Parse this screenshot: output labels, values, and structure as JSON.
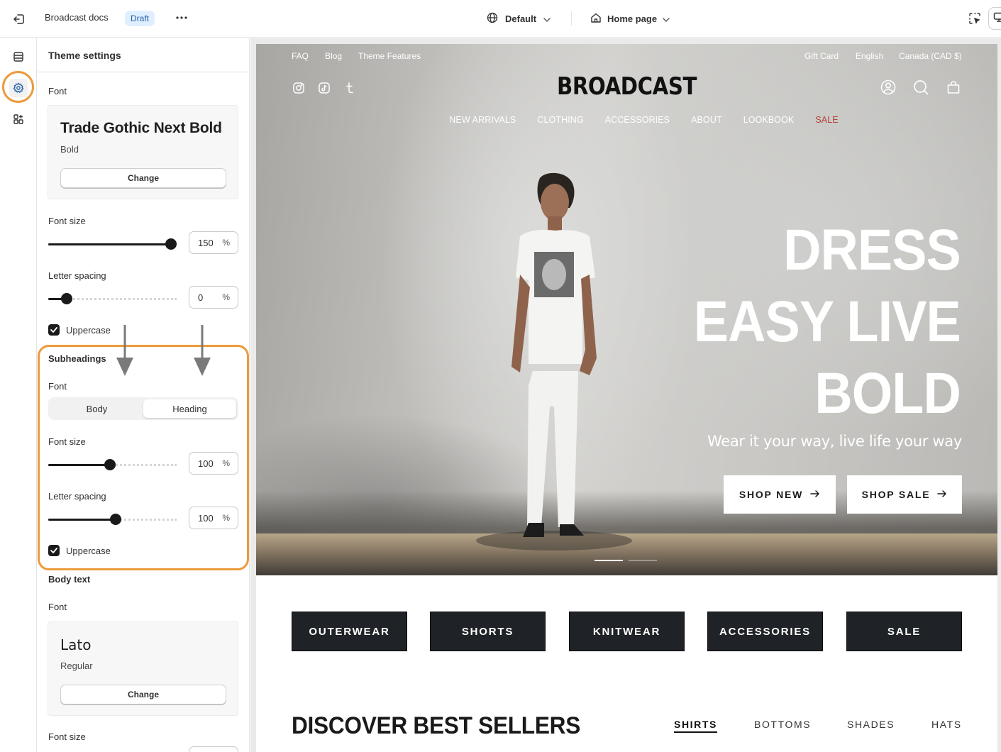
{
  "topbar": {
    "store_name": "Broadcast docs",
    "status_badge": "Draft",
    "theme_selector": "Default",
    "page_selector": "Home page"
  },
  "rail": {
    "items": [
      "sections-icon",
      "theme-settings-icon",
      "app-blocks-icon"
    ]
  },
  "panel": {
    "title": "Theme settings",
    "headings": {
      "font_label": "Font",
      "font_name": "Trade Gothic Next Bold",
      "font_style": "Bold",
      "change_label": "Change",
      "font_size_label": "Font size",
      "font_size_value": "150",
      "font_size_level": 1.0,
      "letter_spacing_label": "Letter spacing",
      "letter_spacing_value": "0",
      "letter_spacing_level": 0.15,
      "uppercase_label": "Uppercase"
    },
    "subheadings": {
      "title": "Subheadings",
      "font_label": "Font",
      "options": [
        "Body",
        "Heading"
      ],
      "selected": "Heading",
      "font_size_label": "Font size",
      "font_size_value": "100",
      "font_size_level": 0.5,
      "letter_spacing_label": "Letter spacing",
      "letter_spacing_value": "100",
      "letter_spacing_level": 0.55,
      "uppercase_label": "Uppercase"
    },
    "body_text": {
      "title": "Body text",
      "font_label": "Font",
      "font_name": "Lato",
      "font_style": "Regular",
      "change_label": "Change",
      "font_size_label": "Font size"
    },
    "unit": "%"
  },
  "store": {
    "utility_left": [
      "FAQ",
      "Blog",
      "Theme Features"
    ],
    "utility_right": [
      "Gift Card",
      "English",
      "Canada (CAD $)"
    ],
    "logo": "BROADCAST",
    "nav": [
      "NEW ARRIVALS",
      "CLOTHING",
      "ACCESSORIES",
      "ABOUT",
      "LOOKBOOK",
      "SALE"
    ],
    "hero": {
      "title_lines": [
        "DRESS",
        "EASY LIVE",
        "BOLD"
      ],
      "subtitle": "Wear it your way, live life your way",
      "buttons": [
        "SHOP NEW",
        "SHOP SALE"
      ]
    },
    "categories": [
      "OUTERWEAR",
      "SHORTS",
      "KNITWEAR",
      "ACCESSORIES",
      "SALE"
    ],
    "best_sellers": {
      "title": "DISCOVER BEST SELLERS",
      "tabs": [
        "SHIRTS",
        "BOTTOMS",
        "SHADES",
        "HATS"
      ],
      "active_tab": "SHIRTS"
    }
  },
  "colors": {
    "highlight": "#ec9a3c",
    "sale_red": "#b5413a",
    "category_bg": "#1f2226",
    "badge_bg": "#e0efff"
  }
}
